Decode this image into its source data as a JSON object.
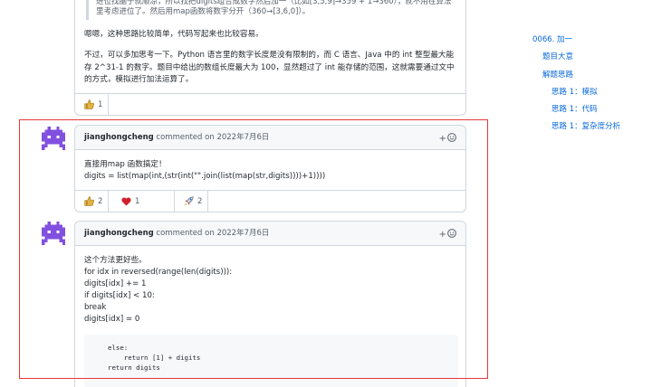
{
  "previous_comment": {
    "quote_line1": "进位找脑子就顺凉，所以找把digits组合成数字然后加一（比如[3,5,9]→359 + 1→360），就不用在算法",
    "quote_line2": "里考虑进位了。然后用map函数将数字分开（360→[3,6,0]）。",
    "para1": "嗯嗯，这种思路比较简单，代码写起来也比较容易。",
    "para2_line1": "不过，可以多加思考一下。Python 语言里的数字长度是没有限制的，而 C 语言、Java 中的 int 整型最大能",
    "para2_line2": "存 2^31-1 的数字。题目中给出的数组长度最大为 100，显然超过了 int 能存储的范围，这就需要通过文中",
    "para2_line3": "的方式，模拟进行加法运算了。",
    "reactions": [
      {
        "icon": "thumbs-up-icon",
        "count": "1"
      }
    ]
  },
  "toc": {
    "items": [
      {
        "label": "0066. 加一",
        "level": 1
      },
      {
        "label": "题目大意",
        "level": 2
      },
      {
        "label": "解题思路",
        "level": 2
      },
      {
        "label": "思路 1：模拟",
        "level": 3
      },
      {
        "label": "思路 1：代码",
        "level": 3
      },
      {
        "label": "思路 1：复杂度分析",
        "level": 3
      }
    ],
    "link_color": "#0969da"
  },
  "comments": [
    {
      "author": "jianghongcheng",
      "action": "commented on",
      "date": "2022年7月6日",
      "add_reaction_symbol": "+",
      "lines": [
        "直接用map 函数搞定！",
        "digits = list(map(int,(str(int(\"\".join(list(map(str,digits))))+1))))"
      ],
      "reactions": [
        {
          "icon": "thumbs-up-icon",
          "count": "2"
        },
        {
          "icon": "heart-icon",
          "count": "1"
        },
        {
          "icon": "rocket-icon",
          "count": "2"
        }
      ]
    },
    {
      "author": "jianghongcheng",
      "action": "commented on",
      "date": "2022年7月6日",
      "add_reaction_symbol": "+",
      "lines": [
        "这个方法更好些。",
        "for idx in reversed(range(len(digits))):",
        "digits[idx] += 1",
        "if digits[idx] < 10:",
        "break",
        "digits[idx] = 0"
      ],
      "code_lines": [
        "else:",
        "    return [1] + digits",
        "return digits"
      ]
    }
  ],
  "colors": {
    "highlight_border": "#e5383b",
    "avatar": "#8250df",
    "heart": "#cf222e",
    "thumbs_up": "#e3b341"
  }
}
